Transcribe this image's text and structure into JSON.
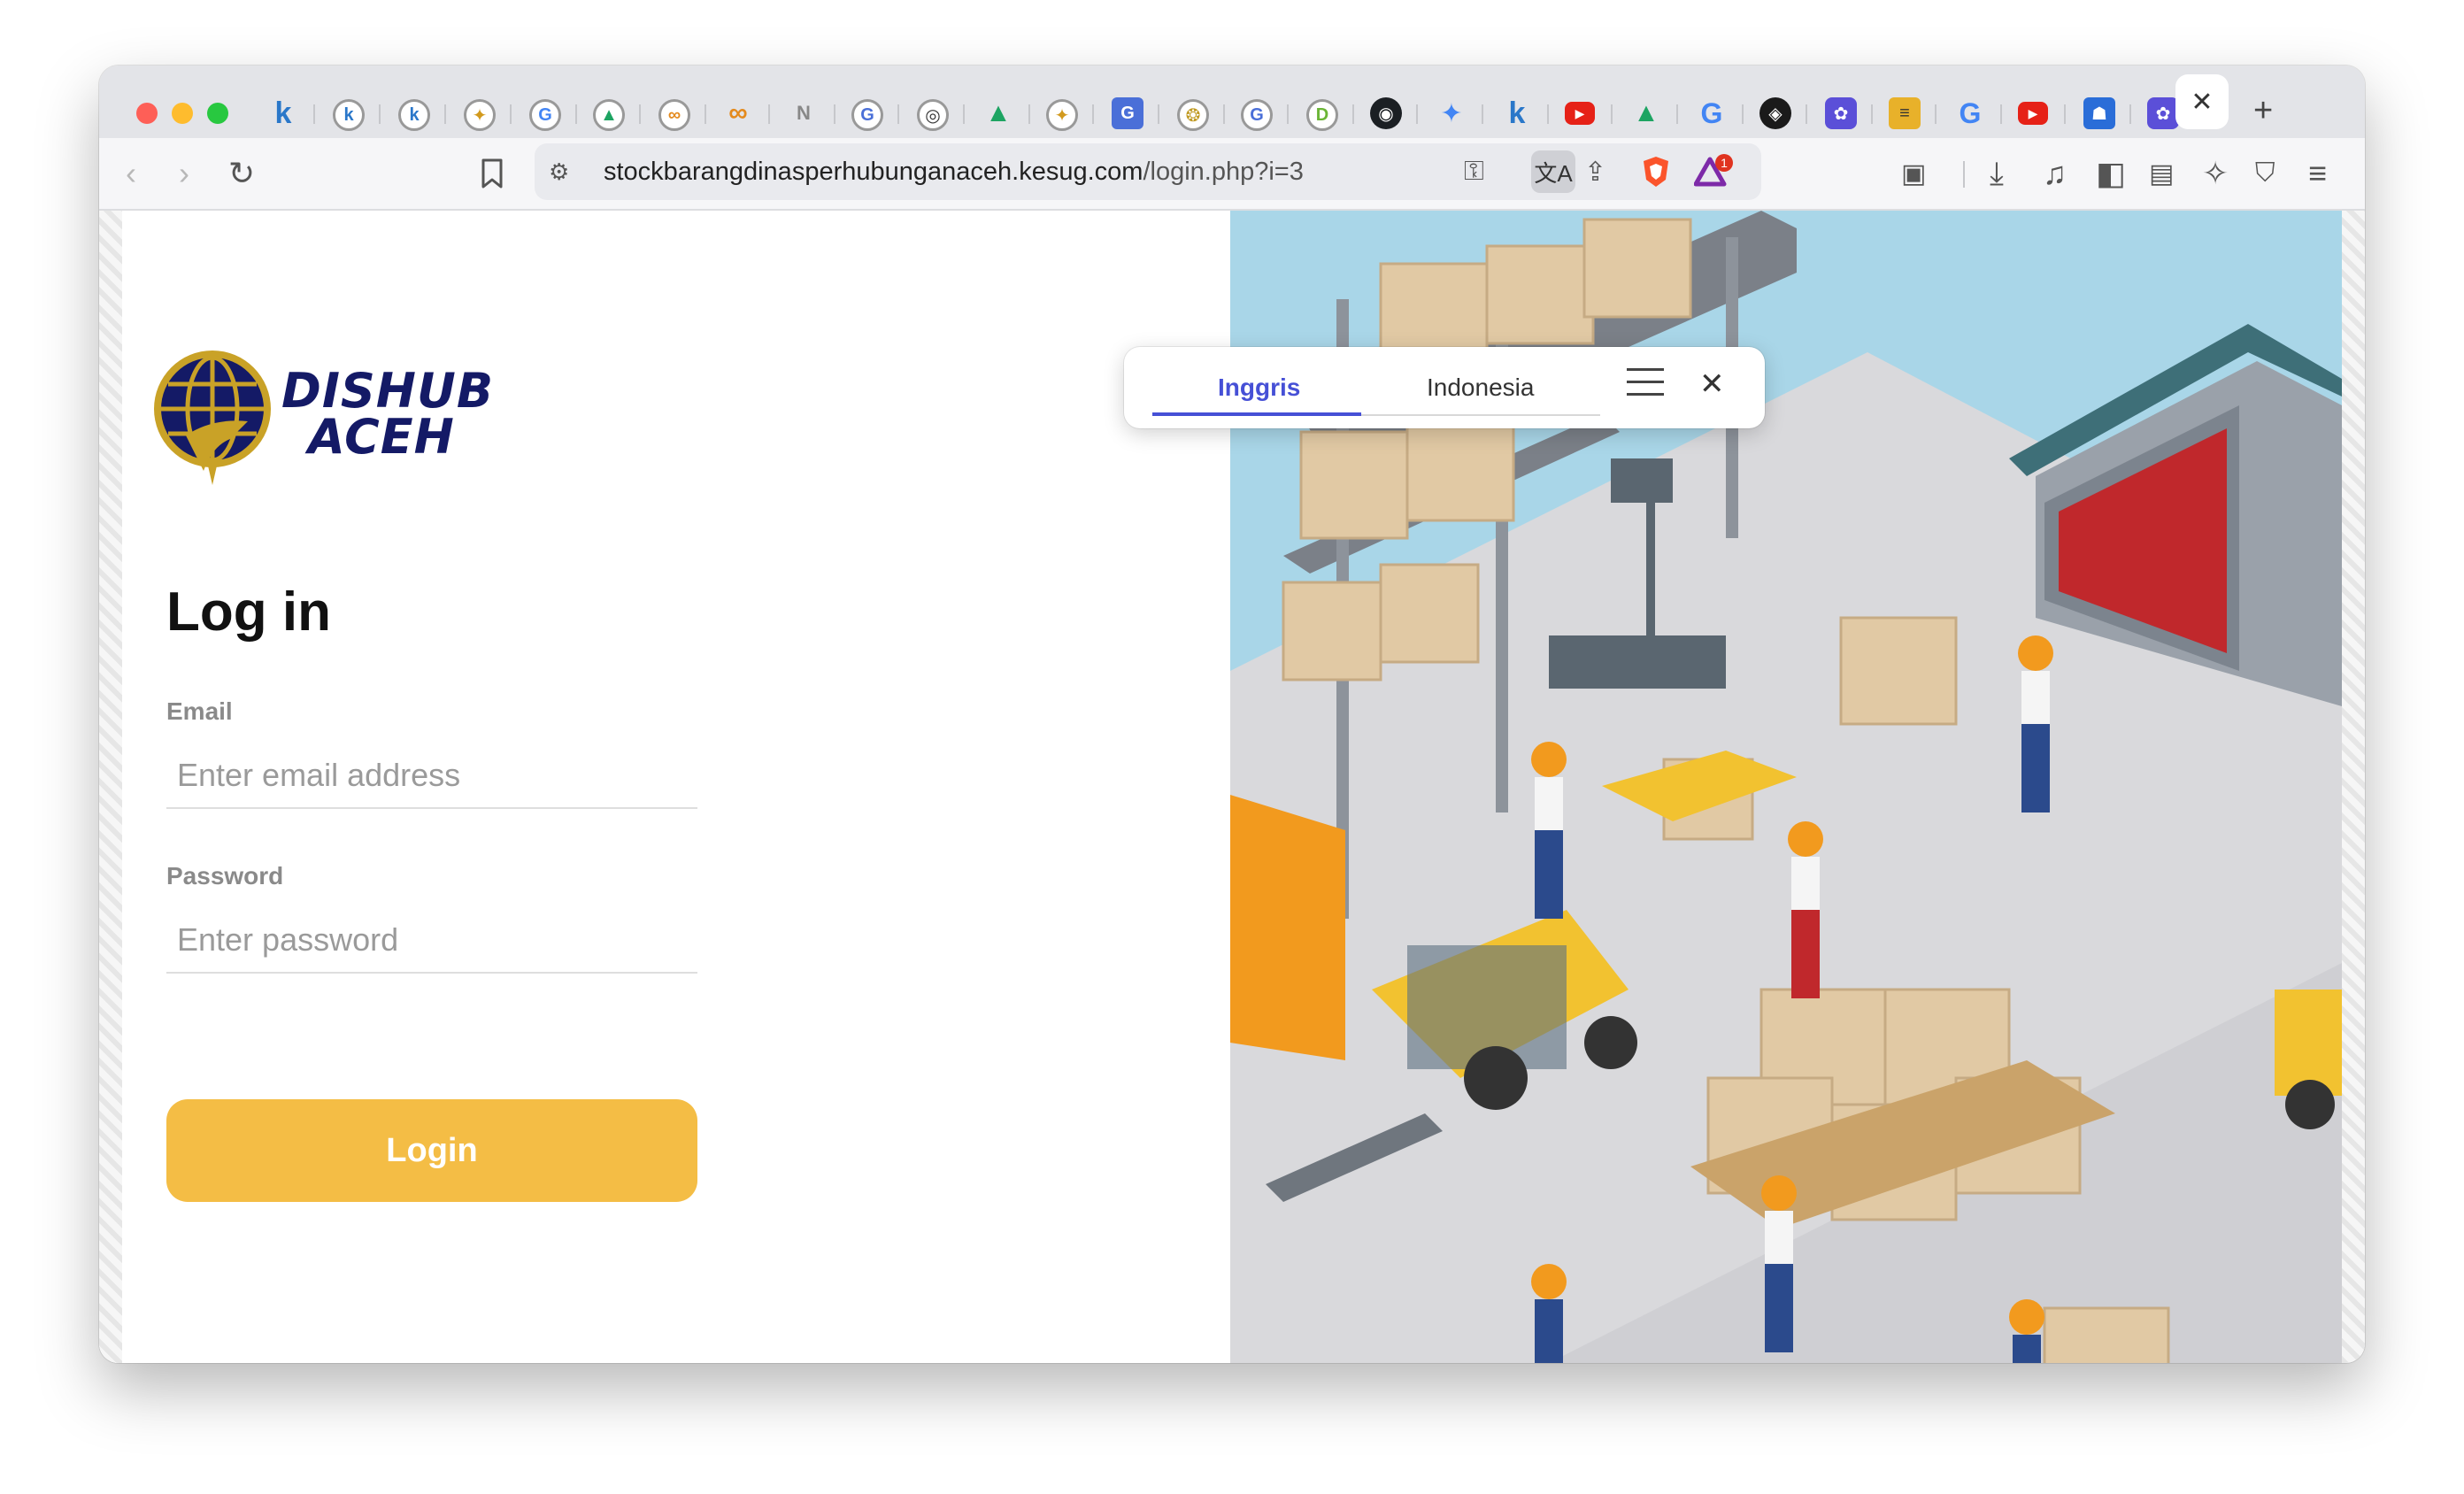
{
  "browser": {
    "tabs": {
      "close_label": "✕",
      "new_tab_label": "+"
    },
    "url": {
      "domain": "stockbarangdinasperhubunganaceh.kesug.com",
      "path": "/login.php?i=3"
    },
    "shield_badge": "1"
  },
  "translate_popup": {
    "tabs": [
      "Inggris",
      "Indonesia"
    ],
    "close_label": "✕"
  },
  "brand": {
    "line1": "DISHUB",
    "line2": "ACEH",
    "color": "#141a66"
  },
  "login": {
    "title": "Log in",
    "email_label": "Email",
    "email_placeholder": "Enter email address",
    "password_label": "Password",
    "password_placeholder": "Enter password",
    "button_label": "Login",
    "button_color": "#f4bd45"
  }
}
